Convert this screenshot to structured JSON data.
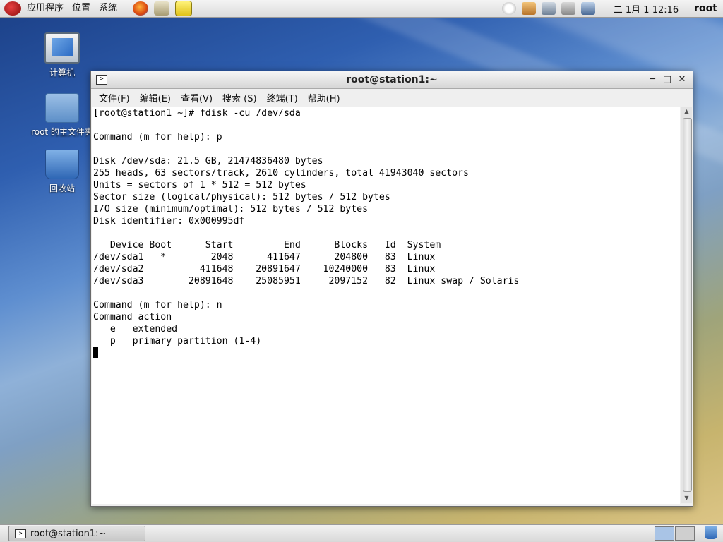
{
  "top_panel": {
    "menus": [
      "应用程序",
      "位置",
      "系统"
    ],
    "clock": "二 1月 1 12:16",
    "user": "root"
  },
  "desktop": {
    "icons": [
      {
        "label": "计算机",
        "icon": "computer-icon"
      },
      {
        "label": "root 的主文件夹",
        "icon": "home-folder-icon"
      },
      {
        "label": "回收站",
        "icon": "trash-icon"
      }
    ]
  },
  "window": {
    "title": "root@station1:~",
    "menus": [
      "文件(F)",
      "编辑(E)",
      "查看(V)",
      "搜索 (S)",
      "终端(T)",
      "帮助(H)"
    ]
  },
  "terminal": {
    "lines": [
      "[root@station1 ~]# fdisk -cu /dev/sda",
      "",
      "Command (m for help): p",
      "",
      "Disk /dev/sda: 21.5 GB, 21474836480 bytes",
      "255 heads, 63 sectors/track, 2610 cylinders, total 41943040 sectors",
      "Units = sectors of 1 * 512 = 512 bytes",
      "Sector size (logical/physical): 512 bytes / 512 bytes",
      "I/O size (minimum/optimal): 512 bytes / 512 bytes",
      "Disk identifier: 0x000995df",
      "",
      "   Device Boot      Start         End      Blocks   Id  System",
      "/dev/sda1   *        2048      411647      204800   83  Linux",
      "/dev/sda2          411648    20891647    10240000   83  Linux",
      "/dev/sda3        20891648    25085951     2097152   82  Linux swap / Solaris",
      "",
      "Command (m for help): n",
      "Command action",
      "   e   extended",
      "   p   primary partition (1-4)"
    ]
  },
  "taskbar": {
    "task_label": "root@station1:~"
  }
}
